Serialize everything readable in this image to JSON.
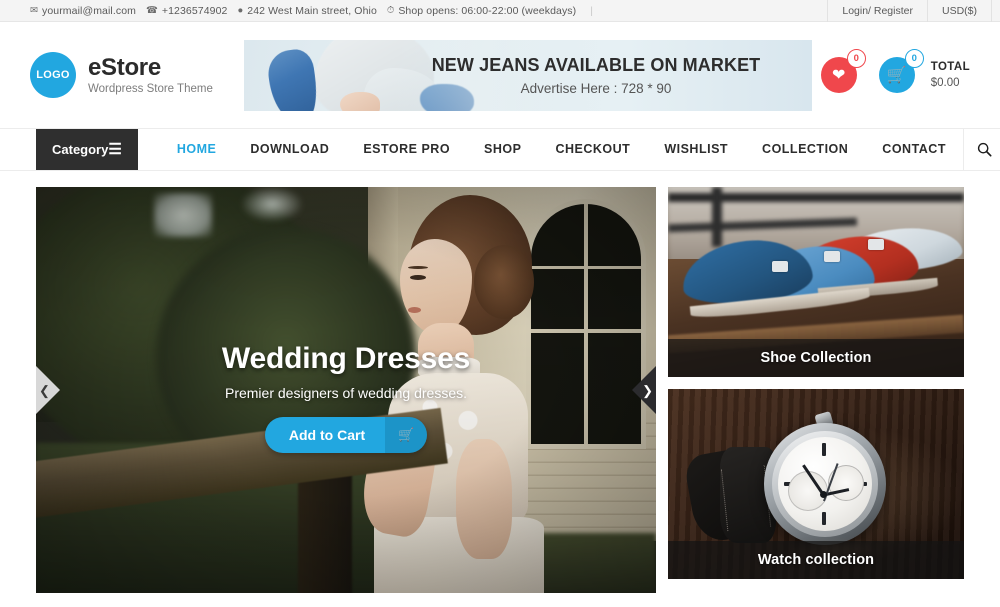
{
  "topbar": {
    "email": "yourmail@mail.com",
    "phone": "+1236574902",
    "address": "242 West Main street, Ohio",
    "hours": "Shop opens: 06:00-22:00 (weekdays)",
    "login": "Login/ Register",
    "currency": "USD($)"
  },
  "header": {
    "logo_text": "LOGO",
    "brand_name": "eStore",
    "brand_tagline": "Wordpress Store Theme",
    "banner": {
      "title": "NEW JEANS AVAILABLE ON MARKET",
      "subtitle": "Advertise Here : 728 * 90"
    },
    "wishlist_count": "0",
    "cart_count": "0",
    "total_label": "TOTAL",
    "total_value": "$0.00"
  },
  "nav": {
    "category_label": "Category",
    "links": [
      {
        "label": "HOME",
        "active": true
      },
      {
        "label": "DOWNLOAD",
        "active": false
      },
      {
        "label": "ESTORE PRO",
        "active": false
      },
      {
        "label": "SHOP",
        "active": false
      },
      {
        "label": "CHECKOUT",
        "active": false
      },
      {
        "label": "WISHLIST",
        "active": false
      },
      {
        "label": "COLLECTION",
        "active": false
      },
      {
        "label": "CONTACT",
        "active": false
      }
    ]
  },
  "hero": {
    "title": "Wedding Dresses",
    "subtitle": "Premier designers of wedding dresses.",
    "cta_label": "Add to Cart"
  },
  "cards": [
    {
      "label": "Shoe Collection"
    },
    {
      "label": "Watch collection"
    }
  ],
  "colors": {
    "accent": "#22a7e0",
    "wishlist": "#f0474c",
    "dark": "#2f2f2f"
  }
}
